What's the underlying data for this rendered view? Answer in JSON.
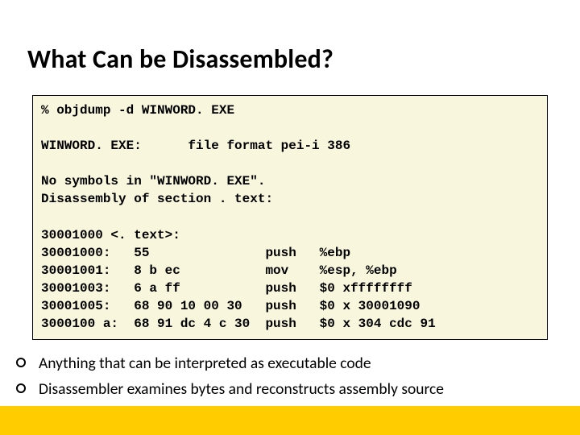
{
  "title": "What Can be Disassembled?",
  "code": "% objdump -d WINWORD. EXE\n\nWINWORD. EXE:      file format pei-i 386\n\nNo symbols in \"WINWORD. EXE\".\nDisassembly of section . text:\n\n30001000 <. text>:\n30001000:   55               push   %ebp\n30001001:   8 b ec           mov    %esp, %ebp\n30001003:   6 a ff           push   $0 xffffffff\n30001005:   68 90 10 00 30   push   $0 x 30001090\n3000100 a:  68 91 dc 4 c 30  push   $0 x 304 cdc 91",
  "bullets": [
    "Anything that can be interpreted as executable code",
    "Disassembler examines bytes and reconstructs assembly source"
  ]
}
